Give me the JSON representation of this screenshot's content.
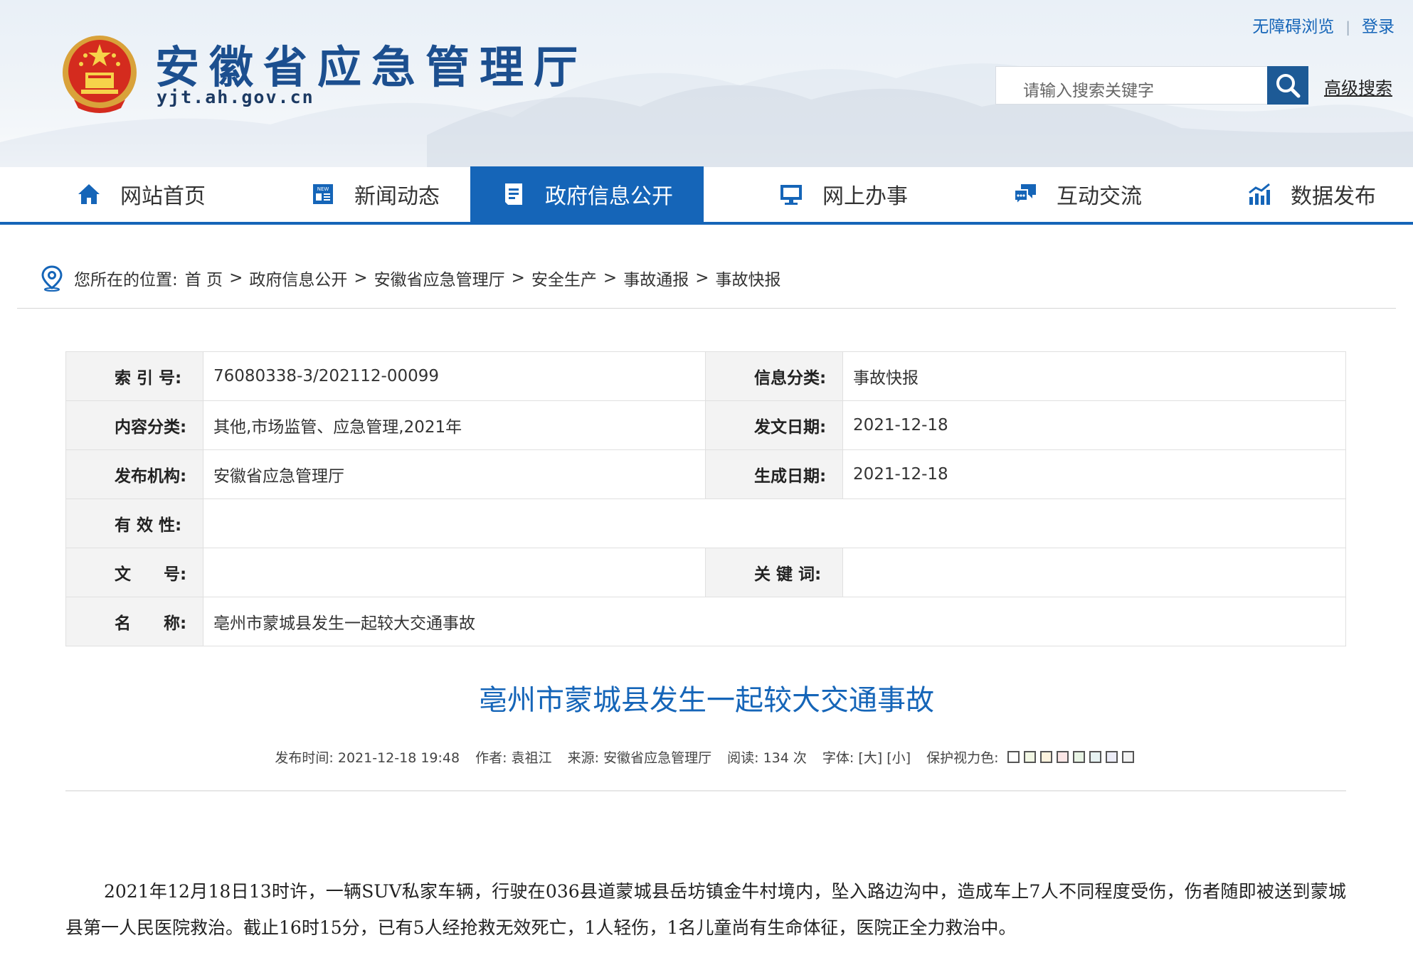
{
  "top_links": {
    "accessibility": "无障碍浏览",
    "login": "登录"
  },
  "site": {
    "title": "安徽省应急管理厅",
    "domain": "yjt.ah.gov.cn"
  },
  "search": {
    "placeholder": "请输入搜索关键字",
    "advanced_label": "高级搜索"
  },
  "nav": [
    {
      "label": "网站首页",
      "icon": "home-icon"
    },
    {
      "label": "新闻动态",
      "icon": "news-icon"
    },
    {
      "label": "政府信息公开",
      "icon": "document-icon"
    },
    {
      "label": "网上办事",
      "icon": "monitor-icon"
    },
    {
      "label": "互动交流",
      "icon": "chat-icon"
    },
    {
      "label": "数据发布",
      "icon": "chart-icon"
    }
  ],
  "breadcrumb": {
    "prefix": "您所在的位置:",
    "items": [
      "首 页",
      "政府信息公开",
      "安徽省应急管理厅",
      "安全生产",
      "事故通报",
      "事故快报"
    ]
  },
  "meta": {
    "index_no_label": "索 引 号:",
    "index_no": "76080338-3/202112-00099",
    "info_category_label": "信息分类:",
    "info_category": "事故快报",
    "content_category_label": "内容分类:",
    "content_category": "其他,市场监管、应急管理,2021年",
    "issue_date_label": "发文日期:",
    "issue_date": "2021-12-18",
    "publisher_label": "发布机构:",
    "publisher": "安徽省应急管理厅",
    "created_date_label": "生成日期:",
    "created_date": "2021-12-18",
    "validity_label": "有 效 性:",
    "validity": "",
    "doc_no_label": "文　　号:",
    "doc_no": "",
    "keywords_label": "关 键 词:",
    "keywords": "",
    "name_label": "名　　称:",
    "name": "亳州市蒙城县发生一起较大交通事故"
  },
  "article": {
    "title": "亳州市蒙城县发生一起较大交通事故",
    "publish_time": "发布时间: 2021-12-18 19:48",
    "author": "作者: 袁祖江",
    "source": "来源: 安徽省应急管理厅",
    "reads": "阅读: 134 次",
    "font_size": "字体: [大] [小]",
    "eye_care_label": "保护视力色:",
    "eye_care_colors": [
      "#ffffff",
      "#f2f7e4",
      "#fdf3de",
      "#fbe6e6",
      "#e8f4e4",
      "#e6f2f2",
      "#ececf7",
      "#f2f2f2"
    ],
    "body": "2021年12月18日13时许，一辆SUV私家车辆，行驶在036县道蒙城县岳坊镇金牛村境内，坠入路边沟中，造成车上7人不同程度受伤，伤者随即被送到蒙城县第一人民医院救治。截止16时15分，已有5人经抢救无效死亡，1人轻伤，1名儿童尚有生命体征，医院正全力救治中。"
  },
  "colors": {
    "brand_blue": "#1565b8",
    "search_button": "#1d5a96"
  }
}
